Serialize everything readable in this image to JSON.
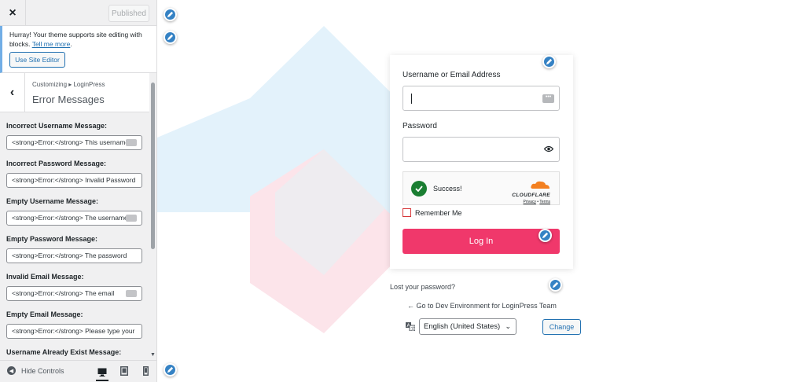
{
  "topbar": {
    "close_icon": "×",
    "published_label": "Published"
  },
  "notice": {
    "text": "Hurray! Your theme supports site editing with blocks.",
    "link": "Tell me more",
    "button": "Use Site Editor"
  },
  "section": {
    "back_icon": "‹",
    "breadcrumb": "Customizing ▸ LoginPress",
    "title": "Error Messages"
  },
  "fields": [
    {
      "label": "Incorrect Username Message:",
      "value": "<strong>Error:</strong> This username"
    },
    {
      "label": "Incorrect Password Message:",
      "value": "<strong>Error:</strong> Invalid Password"
    },
    {
      "label": "Empty Username Message:",
      "value": "<strong>Error:</strong> The username"
    },
    {
      "label": "Empty Password Message:",
      "value": "<strong>Error:</strong> The password"
    },
    {
      "label": "Invalid Email Message:",
      "value": "<strong>Error:</strong> The email"
    },
    {
      "label": "Empty Email Message:",
      "value": "<strong>Error:</strong> Please type your"
    },
    {
      "label": "Username Already Exist Message:",
      "value": ""
    }
  ],
  "footer": {
    "hide_controls": "Hide Controls"
  },
  "login": {
    "username_label": "Username or Email Address",
    "password_label": "Password",
    "captcha_status": "Success!",
    "cloudflare_brand": "CLOUDFLARE",
    "cloudflare_privacy": "Privacy",
    "cloudflare_sep": " • ",
    "cloudflare_terms": "Terms",
    "remember_label": "Remember Me",
    "submit_label": "Log In",
    "accent_color": "#f0386b"
  },
  "links": {
    "lost_password": "Lost your password?",
    "back_to_site": "← Go to Dev Environment for LoginPress Team"
  },
  "language": {
    "selected": "English (United States)",
    "change_label": "Change"
  },
  "icons": [
    "close-icon",
    "back-icon",
    "hide-controls-icon",
    "desktop-icon",
    "tablet-icon",
    "mobile-icon",
    "edit-shortcut-icon",
    "eye-icon",
    "password-manager-icon",
    "checkmark-icon",
    "cloudflare-cloud-icon",
    "translate-icon",
    "chevron-down-icon"
  ]
}
